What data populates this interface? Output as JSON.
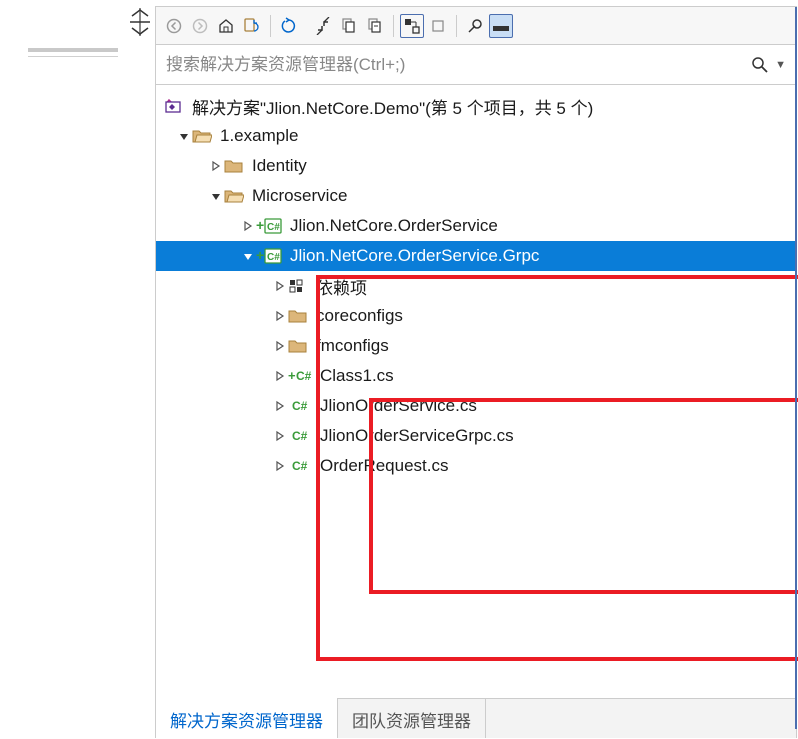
{
  "search": {
    "placeholder": "搜索解决方案资源管理器(Ctrl+;)"
  },
  "sln": {
    "title_prefix": "解决方案\"",
    "name": "Jlion.NetCore.Demo",
    "title_suffix": "\"(第 5 个项目，共 5 个)"
  },
  "tree": {
    "folder_example": "1.example",
    "folder_identity": "Identity",
    "folder_microservice": "Microservice",
    "proj_orderservice": "Jlion.NetCore.OrderService",
    "proj_grpc": "Jlion.NetCore.OrderService.Grpc",
    "deps": "依赖项",
    "coreconfigs": "coreconfigs",
    "fmconfigs": "fmconfigs",
    "class1": "Class1.cs",
    "svc_cs": "JlionOrderService.cs",
    "svc_grpc_cs": "JlionOrderServiceGrpc.cs",
    "orderreq_cs": "OrderRequest.cs"
  },
  "tabs": {
    "solution_explorer": "解决方案资源管理器",
    "team_explorer": "团队资源管理器"
  },
  "colors": {
    "selection": "#0a7dd8",
    "highlight": "#eb1c24",
    "csharp_green": "#3a9b3a",
    "folder": "#dcb67a"
  }
}
